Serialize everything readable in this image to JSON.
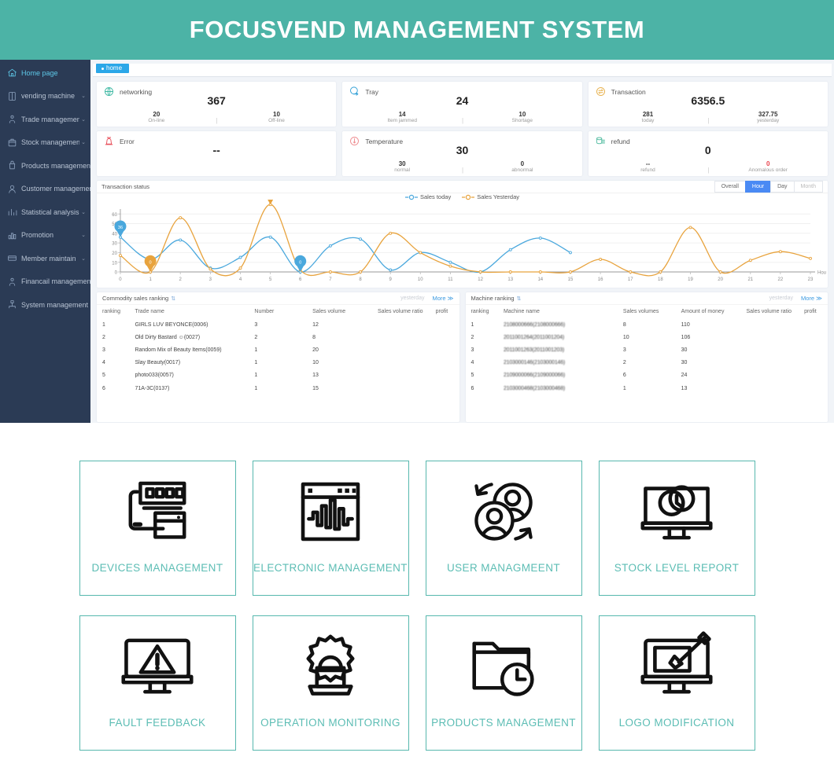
{
  "header": {
    "title": "FOCUSVEND MANAGEMENT SYSTEM",
    "brand_color": "#4cb3a6"
  },
  "sidebar": {
    "items": [
      {
        "label": "Home page",
        "icon": "home-icon",
        "arrow": "",
        "active": true
      },
      {
        "label": "vending machine",
        "icon": "machine-icon",
        "arrow": "⌄",
        "active": false
      },
      {
        "label": "Trade management",
        "icon": "trade-icon",
        "arrow": "⌄",
        "active": false
      },
      {
        "label": "Stock management",
        "icon": "stock-icon",
        "arrow": "⌄",
        "active": false
      },
      {
        "label": "Products management",
        "icon": "products-icon",
        "arrow": "",
        "active": false
      },
      {
        "label": "Customer management",
        "icon": "customer-icon",
        "arrow": "",
        "active": false
      },
      {
        "label": "Statistical analysis",
        "icon": "stats-icon",
        "arrow": "⌄",
        "active": false
      },
      {
        "label": "Promotion",
        "icon": "promotion-icon",
        "arrow": "⌄",
        "active": false
      },
      {
        "label": "Member maintain",
        "icon": "member-icon",
        "arrow": "⌄",
        "active": false
      },
      {
        "label": "Financail management",
        "icon": "finance-icon",
        "arrow": "",
        "active": false
      },
      {
        "label": "System management",
        "icon": "system-icon",
        "arrow": "",
        "active": false
      }
    ]
  },
  "tabs": {
    "home": "home"
  },
  "stats": [
    {
      "title": "networking",
      "icon": "globe-icon",
      "big": "367",
      "left_value": "20",
      "left_label": "On-line",
      "right_value": "10",
      "right_label": "Off-line",
      "left_red": false,
      "right_red": false
    },
    {
      "title": "Tray",
      "icon": "tray-icon",
      "big": "24",
      "left_value": "14",
      "left_label": "Item jammed",
      "right_value": "10",
      "right_label": "Shortage",
      "left_red": false,
      "right_red": false
    },
    {
      "title": "Transaction",
      "icon": "transaction-icon",
      "big": "6356.5",
      "left_value": "281",
      "left_label": "today",
      "right_value": "327.75",
      "right_label": "yesterday",
      "left_red": false,
      "right_red": false
    },
    {
      "title": "Error",
      "icon": "error-icon",
      "big": "--",
      "left_value": "",
      "left_label": "",
      "right_value": "",
      "right_label": "",
      "left_red": false,
      "right_red": false
    },
    {
      "title": "Temperature",
      "icon": "temperature-icon",
      "big": "30",
      "left_value": "30",
      "left_label": "normal",
      "right_value": "0",
      "right_label": "abnormal",
      "left_red": false,
      "right_red": false
    },
    {
      "title": "refund",
      "icon": "refund-icon",
      "big": "0",
      "left_value": "--",
      "left_label": "refund",
      "right_value": "0",
      "right_label": "Anomalous order",
      "left_red": false,
      "right_red": true
    }
  ],
  "chart_panel": {
    "title": "Transaction status",
    "ranges": [
      {
        "label": "Overall",
        "state": "normal"
      },
      {
        "label": "Hour",
        "state": "active"
      },
      {
        "label": "Day",
        "state": "normal"
      },
      {
        "label": "Month",
        "state": "muted"
      }
    ]
  },
  "chart_data": {
    "type": "line",
    "title": "Transaction status",
    "xlabel": "Hou",
    "ylabel": "",
    "xlim": [
      0,
      23
    ],
    "ylim": [
      0,
      65
    ],
    "yticks": [
      0,
      10,
      20,
      30,
      40,
      50,
      60
    ],
    "x": [
      0,
      1,
      2,
      3,
      4,
      5,
      6,
      7,
      8,
      9,
      10,
      11,
      12,
      13,
      14,
      15,
      16,
      17,
      18,
      19,
      20,
      21,
      22,
      23
    ],
    "grid": true,
    "legend_position": "top-center",
    "series": [
      {
        "name": "Sales today",
        "color": "#4aa8dd",
        "values": [
          36,
          13,
          33,
          4,
          15,
          36,
          0,
          27,
          34,
          2,
          20,
          10,
          0,
          23,
          35,
          20,
          null,
          null,
          null,
          null,
          null,
          null,
          null,
          null
        ],
        "markers": [
          {
            "x": 0,
            "y": 36,
            "label": "36"
          },
          {
            "x": 6,
            "y": 0,
            "label": "0"
          }
        ]
      },
      {
        "name": "Sales Yesterday",
        "color": "#e8a33d",
        "values": [
          17,
          0,
          56,
          3,
          4,
          69.75,
          2,
          0,
          0,
          40,
          20,
          6,
          0,
          0,
          0,
          0,
          13,
          0,
          0,
          46,
          0,
          12,
          21,
          14
        ],
        "markers": [
          {
            "x": 1,
            "y": 0,
            "label": "0"
          },
          {
            "x": 5,
            "y": 69.75,
            "label": "69.75"
          }
        ]
      }
    ]
  },
  "commodity_ranking": {
    "title": "Commodity sales ranking",
    "period": "yesterday",
    "more": "More ≫",
    "columns": [
      "ranking",
      "Trade name",
      "Number",
      "Sales volume",
      "Sales volume ratio",
      "profit"
    ],
    "rows": [
      [
        "1",
        "GIRLS LUV BEYONCE(0006)",
        "3",
        "12",
        "",
        ""
      ],
      [
        "2",
        "Old Dirty Bastard ☺(0027)",
        "2",
        "8",
        "",
        ""
      ],
      [
        "3",
        "Random Mix of Beauty Items(0059)",
        "1",
        "20",
        "",
        ""
      ],
      [
        "4",
        "Slay Beauty(0017)",
        "1",
        "10",
        "",
        ""
      ],
      [
        "5",
        "photo033(0057)",
        "1",
        "13",
        "",
        ""
      ],
      [
        "6",
        "71A-3C(0137)",
        "1",
        "15",
        "",
        ""
      ]
    ]
  },
  "machine_ranking": {
    "title": "Machine ranking",
    "period": "yesterday",
    "more": "More ≫",
    "columns": [
      "ranking",
      "Machine name",
      "Sales volumes",
      "Amount of money",
      "Sales volume ratio",
      "profit"
    ],
    "rows": [
      [
        "1",
        "2108000666(2108000666)",
        "8",
        "110",
        "",
        ""
      ],
      [
        "2",
        "2011001264(2011001204)",
        "10",
        "106",
        "",
        ""
      ],
      [
        "3",
        "2011001263(2011001203)",
        "3",
        "30",
        "",
        ""
      ],
      [
        "4",
        "2103000146(2103000146)",
        "2",
        "30",
        "",
        ""
      ],
      [
        "5",
        "2109000066(2109000066)",
        "6",
        "24",
        "",
        ""
      ],
      [
        "6",
        "2103000468(2103000468)",
        "1",
        "13",
        "",
        ""
      ]
    ]
  },
  "features": [
    [
      {
        "label": "DEVICES MANAGEMENT",
        "icon": "devices-icon"
      },
      {
        "label": "ELECTRONIC MANAGEMENT",
        "icon": "waveform-icon"
      },
      {
        "label": "USER MANAGMEENT",
        "icon": "users-icon"
      },
      {
        "label": "STOCK LEVEL REPORT",
        "icon": "monitor-chart-icon"
      }
    ],
    [
      {
        "label": "FAULT FEEDBACK",
        "icon": "monitor-warning-icon"
      },
      {
        "label": "OPERATION MONITORING",
        "icon": "gear-laptop-icon"
      },
      {
        "label": "PRODUCTS MANAGEMENT",
        "icon": "folder-clock-icon"
      },
      {
        "label": "LOGO MODIFICATION",
        "icon": "monitor-brush-icon"
      }
    ]
  ]
}
